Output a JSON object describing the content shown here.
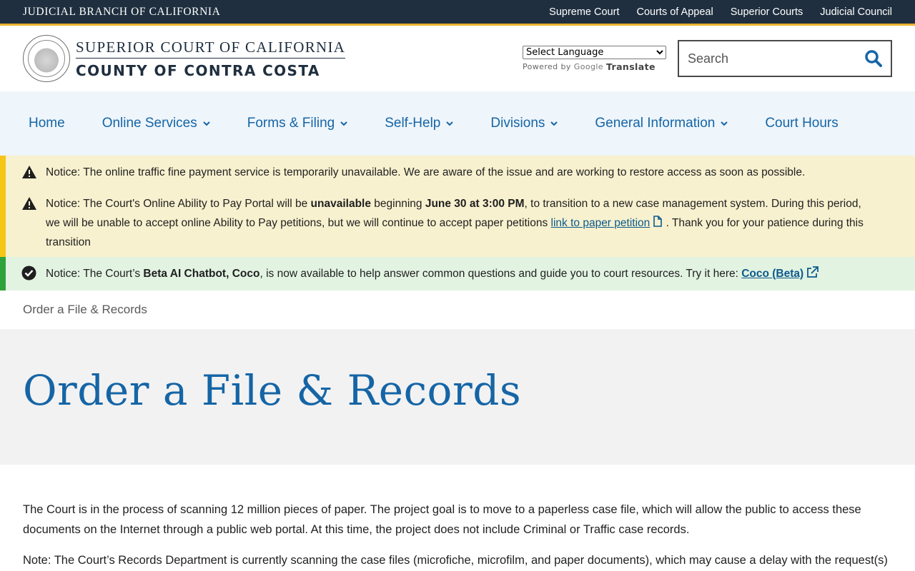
{
  "topbar": {
    "brand": "JUDICIAL BRANCH OF CALIFORNIA",
    "links": [
      "Supreme Court",
      "Courts of Appeal",
      "Superior Courts",
      "Judicial Council"
    ]
  },
  "header": {
    "line1": "SUPERIOR COURT OF CALIFORNIA",
    "line2": "COUNTY OF CONTRA COSTA",
    "language_select": "Select Language",
    "powered_by": "Powered by",
    "google": "Google",
    "translate": "Translate",
    "search_placeholder": "Search"
  },
  "nav": {
    "items": [
      {
        "label": "Home",
        "dropdown": false
      },
      {
        "label": "Online Services",
        "dropdown": true
      },
      {
        "label": "Forms & Filing",
        "dropdown": true
      },
      {
        "label": "Self-Help",
        "dropdown": true
      },
      {
        "label": "Divisions",
        "dropdown": true
      },
      {
        "label": "General Information",
        "dropdown": true
      },
      {
        "label": "Court Hours",
        "dropdown": false
      }
    ]
  },
  "notices": {
    "n1": {
      "prefix": "Notice:",
      "text": " The online traffic fine payment service is temporarily unavailable. We are aware of the issue and are working to restore access as soon as possible."
    },
    "n2": {
      "prefix": "Notice:",
      "t1": " The Court's Online Ability to Pay Portal will be ",
      "b1": "unavailable",
      "t2": " beginning ",
      "b2": "June 30 at 3:00 PM",
      "t3": ", to transition to a new case management system. During this period, we will be unable to accept online Ability to Pay petitions, but we will continue to accept paper petitions ",
      "link": "link to paper petition",
      "t4": " . Thank you for your patience during this transition"
    },
    "n3": {
      "prefix": "Notice:",
      "t1": " The Court’s ",
      "b1": "Beta AI Chatbot, Coco",
      "t2": ", is now available to help answer common questions and guide you to court resources. Try it here: ",
      "link": "Coco (Beta)"
    }
  },
  "breadcrumb": "Order a File & Records",
  "page_title": "Order a File & Records",
  "content": {
    "p1": "The Court is in the process of scanning 12 million pieces of paper. The project goal is to move to a paperless case file, which will allow the public to access these documents on the Internet through a public web portal. At this time, the project does not include Criminal or Traffic case records.",
    "p2": "Note: The Court’s Records Department is currently scanning the case files (microfiche, microfilm, and paper documents), which may cause a delay with the request(s)"
  },
  "colors": {
    "topbar": "#1f2f3f",
    "accent_gold": "#e8b32b",
    "link_blue": "#1565a6",
    "nav_bg": "#eef5fb",
    "warn_bg": "#f8f1cf",
    "ok_bg": "#e2f3e2"
  }
}
